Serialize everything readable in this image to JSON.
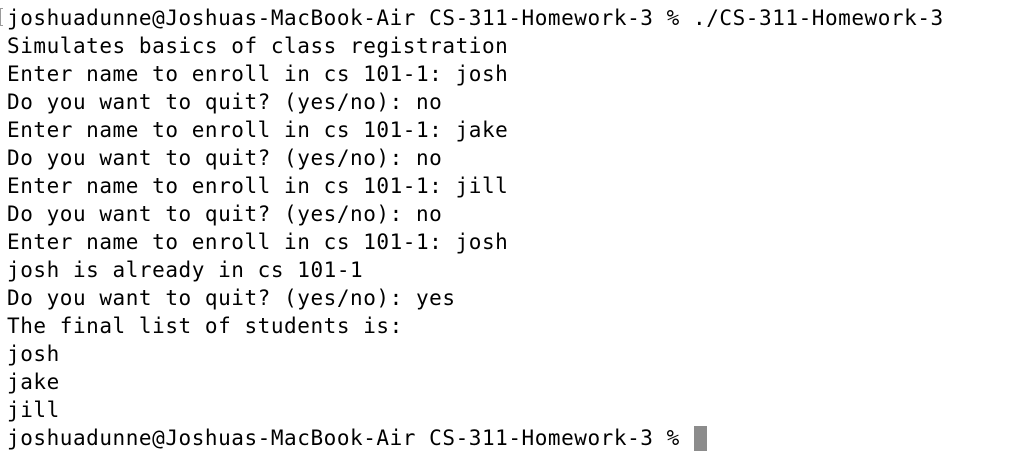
{
  "terminal": {
    "lines": [
      "joshuadunne@Joshuas-MacBook-Air CS-311-Homework-3 % ./CS-311-Homework-3",
      "Simulates basics of class registration",
      "Enter name to enroll in cs 101-1: josh",
      "Do you want to quit? (yes/no): no",
      "Enter name to enroll in cs 101-1: jake",
      "Do you want to quit? (yes/no): no",
      "Enter name to enroll in cs 101-1: jill",
      "Do you want to quit? (yes/no): no",
      "Enter name to enroll in cs 101-1: josh",
      "josh is already in cs 101-1",
      "Do you want to quit? (yes/no): yes",
      "The final list of students is:",
      "josh",
      "jake",
      "jill"
    ],
    "prompt": "joshuadunne@Joshuas-MacBook-Air CS-311-Homework-3 % "
  }
}
